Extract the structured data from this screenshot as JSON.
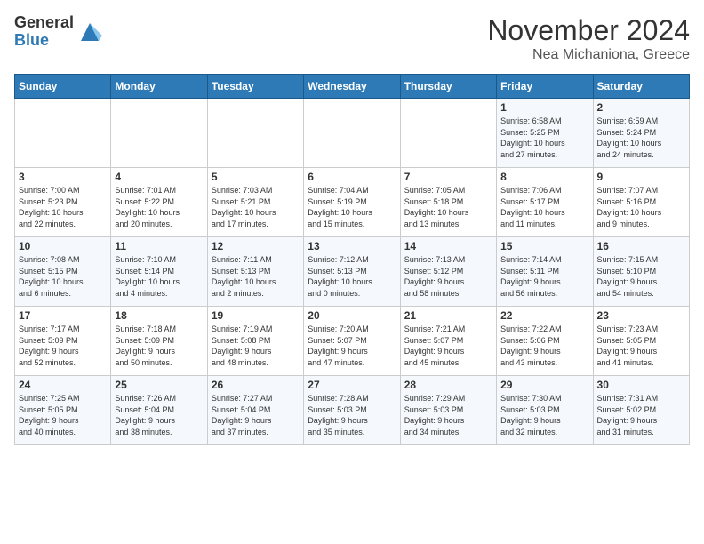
{
  "logo": {
    "general": "General",
    "blue": "Blue"
  },
  "title": "November 2024",
  "location": "Nea Michaniona, Greece",
  "days_of_week": [
    "Sunday",
    "Monday",
    "Tuesday",
    "Wednesday",
    "Thursday",
    "Friday",
    "Saturday"
  ],
  "weeks": [
    [
      {
        "day": "",
        "info": ""
      },
      {
        "day": "",
        "info": ""
      },
      {
        "day": "",
        "info": ""
      },
      {
        "day": "",
        "info": ""
      },
      {
        "day": "",
        "info": ""
      },
      {
        "day": "1",
        "info": "Sunrise: 6:58 AM\nSunset: 5:25 PM\nDaylight: 10 hours\nand 27 minutes."
      },
      {
        "day": "2",
        "info": "Sunrise: 6:59 AM\nSunset: 5:24 PM\nDaylight: 10 hours\nand 24 minutes."
      }
    ],
    [
      {
        "day": "3",
        "info": "Sunrise: 7:00 AM\nSunset: 5:23 PM\nDaylight: 10 hours\nand 22 minutes."
      },
      {
        "day": "4",
        "info": "Sunrise: 7:01 AM\nSunset: 5:22 PM\nDaylight: 10 hours\nand 20 minutes."
      },
      {
        "day": "5",
        "info": "Sunrise: 7:03 AM\nSunset: 5:21 PM\nDaylight: 10 hours\nand 17 minutes."
      },
      {
        "day": "6",
        "info": "Sunrise: 7:04 AM\nSunset: 5:19 PM\nDaylight: 10 hours\nand 15 minutes."
      },
      {
        "day": "7",
        "info": "Sunrise: 7:05 AM\nSunset: 5:18 PM\nDaylight: 10 hours\nand 13 minutes."
      },
      {
        "day": "8",
        "info": "Sunrise: 7:06 AM\nSunset: 5:17 PM\nDaylight: 10 hours\nand 11 minutes."
      },
      {
        "day": "9",
        "info": "Sunrise: 7:07 AM\nSunset: 5:16 PM\nDaylight: 10 hours\nand 9 minutes."
      }
    ],
    [
      {
        "day": "10",
        "info": "Sunrise: 7:08 AM\nSunset: 5:15 PM\nDaylight: 10 hours\nand 6 minutes."
      },
      {
        "day": "11",
        "info": "Sunrise: 7:10 AM\nSunset: 5:14 PM\nDaylight: 10 hours\nand 4 minutes."
      },
      {
        "day": "12",
        "info": "Sunrise: 7:11 AM\nSunset: 5:13 PM\nDaylight: 10 hours\nand 2 minutes."
      },
      {
        "day": "13",
        "info": "Sunrise: 7:12 AM\nSunset: 5:13 PM\nDaylight: 10 hours\nand 0 minutes."
      },
      {
        "day": "14",
        "info": "Sunrise: 7:13 AM\nSunset: 5:12 PM\nDaylight: 9 hours\nand 58 minutes."
      },
      {
        "day": "15",
        "info": "Sunrise: 7:14 AM\nSunset: 5:11 PM\nDaylight: 9 hours\nand 56 minutes."
      },
      {
        "day": "16",
        "info": "Sunrise: 7:15 AM\nSunset: 5:10 PM\nDaylight: 9 hours\nand 54 minutes."
      }
    ],
    [
      {
        "day": "17",
        "info": "Sunrise: 7:17 AM\nSunset: 5:09 PM\nDaylight: 9 hours\nand 52 minutes."
      },
      {
        "day": "18",
        "info": "Sunrise: 7:18 AM\nSunset: 5:09 PM\nDaylight: 9 hours\nand 50 minutes."
      },
      {
        "day": "19",
        "info": "Sunrise: 7:19 AM\nSunset: 5:08 PM\nDaylight: 9 hours\nand 48 minutes."
      },
      {
        "day": "20",
        "info": "Sunrise: 7:20 AM\nSunset: 5:07 PM\nDaylight: 9 hours\nand 47 minutes."
      },
      {
        "day": "21",
        "info": "Sunrise: 7:21 AM\nSunset: 5:07 PM\nDaylight: 9 hours\nand 45 minutes."
      },
      {
        "day": "22",
        "info": "Sunrise: 7:22 AM\nSunset: 5:06 PM\nDaylight: 9 hours\nand 43 minutes."
      },
      {
        "day": "23",
        "info": "Sunrise: 7:23 AM\nSunset: 5:05 PM\nDaylight: 9 hours\nand 41 minutes."
      }
    ],
    [
      {
        "day": "24",
        "info": "Sunrise: 7:25 AM\nSunset: 5:05 PM\nDaylight: 9 hours\nand 40 minutes."
      },
      {
        "day": "25",
        "info": "Sunrise: 7:26 AM\nSunset: 5:04 PM\nDaylight: 9 hours\nand 38 minutes."
      },
      {
        "day": "26",
        "info": "Sunrise: 7:27 AM\nSunset: 5:04 PM\nDaylight: 9 hours\nand 37 minutes."
      },
      {
        "day": "27",
        "info": "Sunrise: 7:28 AM\nSunset: 5:03 PM\nDaylight: 9 hours\nand 35 minutes."
      },
      {
        "day": "28",
        "info": "Sunrise: 7:29 AM\nSunset: 5:03 PM\nDaylight: 9 hours\nand 34 minutes."
      },
      {
        "day": "29",
        "info": "Sunrise: 7:30 AM\nSunset: 5:03 PM\nDaylight: 9 hours\nand 32 minutes."
      },
      {
        "day": "30",
        "info": "Sunrise: 7:31 AM\nSunset: 5:02 PM\nDaylight: 9 hours\nand 31 minutes."
      }
    ]
  ]
}
